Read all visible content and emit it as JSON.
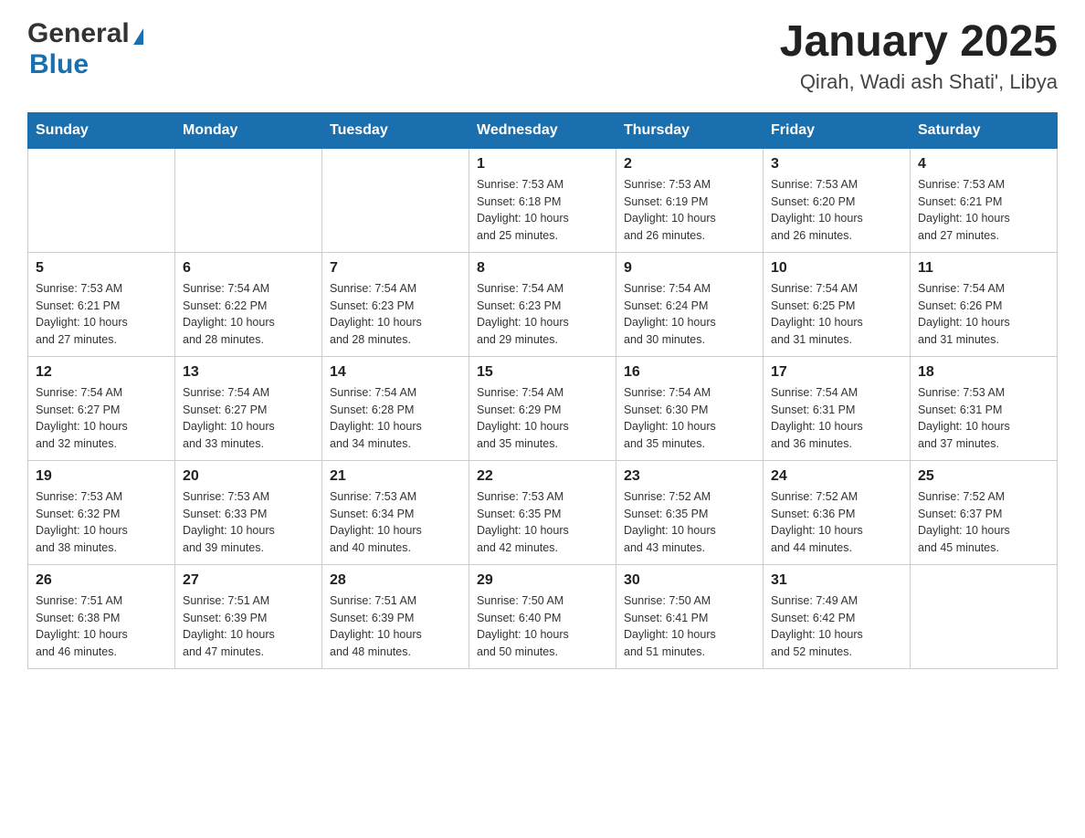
{
  "header": {
    "logo_general": "General",
    "logo_blue": "Blue",
    "title": "January 2025",
    "subtitle": "Qirah, Wadi ash Shati', Libya"
  },
  "days_of_week": [
    "Sunday",
    "Monday",
    "Tuesday",
    "Wednesday",
    "Thursday",
    "Friday",
    "Saturday"
  ],
  "weeks": [
    [
      {
        "day": "",
        "info": ""
      },
      {
        "day": "",
        "info": ""
      },
      {
        "day": "",
        "info": ""
      },
      {
        "day": "1",
        "info": "Sunrise: 7:53 AM\nSunset: 6:18 PM\nDaylight: 10 hours\nand 25 minutes."
      },
      {
        "day": "2",
        "info": "Sunrise: 7:53 AM\nSunset: 6:19 PM\nDaylight: 10 hours\nand 26 minutes."
      },
      {
        "day": "3",
        "info": "Sunrise: 7:53 AM\nSunset: 6:20 PM\nDaylight: 10 hours\nand 26 minutes."
      },
      {
        "day": "4",
        "info": "Sunrise: 7:53 AM\nSunset: 6:21 PM\nDaylight: 10 hours\nand 27 minutes."
      }
    ],
    [
      {
        "day": "5",
        "info": "Sunrise: 7:53 AM\nSunset: 6:21 PM\nDaylight: 10 hours\nand 27 minutes."
      },
      {
        "day": "6",
        "info": "Sunrise: 7:54 AM\nSunset: 6:22 PM\nDaylight: 10 hours\nand 28 minutes."
      },
      {
        "day": "7",
        "info": "Sunrise: 7:54 AM\nSunset: 6:23 PM\nDaylight: 10 hours\nand 28 minutes."
      },
      {
        "day": "8",
        "info": "Sunrise: 7:54 AM\nSunset: 6:23 PM\nDaylight: 10 hours\nand 29 minutes."
      },
      {
        "day": "9",
        "info": "Sunrise: 7:54 AM\nSunset: 6:24 PM\nDaylight: 10 hours\nand 30 minutes."
      },
      {
        "day": "10",
        "info": "Sunrise: 7:54 AM\nSunset: 6:25 PM\nDaylight: 10 hours\nand 31 minutes."
      },
      {
        "day": "11",
        "info": "Sunrise: 7:54 AM\nSunset: 6:26 PM\nDaylight: 10 hours\nand 31 minutes."
      }
    ],
    [
      {
        "day": "12",
        "info": "Sunrise: 7:54 AM\nSunset: 6:27 PM\nDaylight: 10 hours\nand 32 minutes."
      },
      {
        "day": "13",
        "info": "Sunrise: 7:54 AM\nSunset: 6:27 PM\nDaylight: 10 hours\nand 33 minutes."
      },
      {
        "day": "14",
        "info": "Sunrise: 7:54 AM\nSunset: 6:28 PM\nDaylight: 10 hours\nand 34 minutes."
      },
      {
        "day": "15",
        "info": "Sunrise: 7:54 AM\nSunset: 6:29 PM\nDaylight: 10 hours\nand 35 minutes."
      },
      {
        "day": "16",
        "info": "Sunrise: 7:54 AM\nSunset: 6:30 PM\nDaylight: 10 hours\nand 35 minutes."
      },
      {
        "day": "17",
        "info": "Sunrise: 7:54 AM\nSunset: 6:31 PM\nDaylight: 10 hours\nand 36 minutes."
      },
      {
        "day": "18",
        "info": "Sunrise: 7:53 AM\nSunset: 6:31 PM\nDaylight: 10 hours\nand 37 minutes."
      }
    ],
    [
      {
        "day": "19",
        "info": "Sunrise: 7:53 AM\nSunset: 6:32 PM\nDaylight: 10 hours\nand 38 minutes."
      },
      {
        "day": "20",
        "info": "Sunrise: 7:53 AM\nSunset: 6:33 PM\nDaylight: 10 hours\nand 39 minutes."
      },
      {
        "day": "21",
        "info": "Sunrise: 7:53 AM\nSunset: 6:34 PM\nDaylight: 10 hours\nand 40 minutes."
      },
      {
        "day": "22",
        "info": "Sunrise: 7:53 AM\nSunset: 6:35 PM\nDaylight: 10 hours\nand 42 minutes."
      },
      {
        "day": "23",
        "info": "Sunrise: 7:52 AM\nSunset: 6:35 PM\nDaylight: 10 hours\nand 43 minutes."
      },
      {
        "day": "24",
        "info": "Sunrise: 7:52 AM\nSunset: 6:36 PM\nDaylight: 10 hours\nand 44 minutes."
      },
      {
        "day": "25",
        "info": "Sunrise: 7:52 AM\nSunset: 6:37 PM\nDaylight: 10 hours\nand 45 minutes."
      }
    ],
    [
      {
        "day": "26",
        "info": "Sunrise: 7:51 AM\nSunset: 6:38 PM\nDaylight: 10 hours\nand 46 minutes."
      },
      {
        "day": "27",
        "info": "Sunrise: 7:51 AM\nSunset: 6:39 PM\nDaylight: 10 hours\nand 47 minutes."
      },
      {
        "day": "28",
        "info": "Sunrise: 7:51 AM\nSunset: 6:39 PM\nDaylight: 10 hours\nand 48 minutes."
      },
      {
        "day": "29",
        "info": "Sunrise: 7:50 AM\nSunset: 6:40 PM\nDaylight: 10 hours\nand 50 minutes."
      },
      {
        "day": "30",
        "info": "Sunrise: 7:50 AM\nSunset: 6:41 PM\nDaylight: 10 hours\nand 51 minutes."
      },
      {
        "day": "31",
        "info": "Sunrise: 7:49 AM\nSunset: 6:42 PM\nDaylight: 10 hours\nand 52 minutes."
      },
      {
        "day": "",
        "info": ""
      }
    ]
  ]
}
